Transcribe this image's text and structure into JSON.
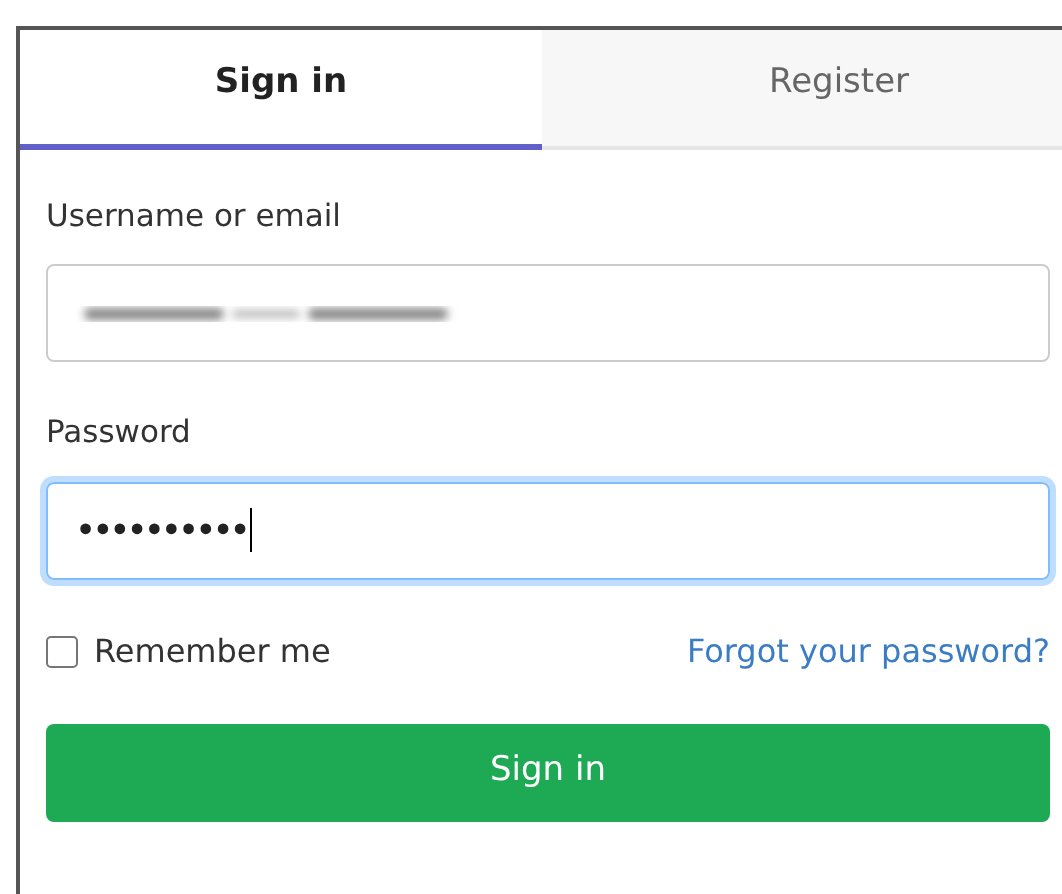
{
  "tabs": [
    {
      "label": "Sign in",
      "selected": true
    },
    {
      "label": "Register",
      "selected": false
    }
  ],
  "form": {
    "username": {
      "label": "Username or email",
      "blurred": true
    },
    "password": {
      "label": "Password",
      "value": "••••••••••",
      "focused": true
    },
    "remember": {
      "label": "Remember me",
      "checked": false
    },
    "forgot_link": "Forgot your password?",
    "submit": "Sign in"
  }
}
